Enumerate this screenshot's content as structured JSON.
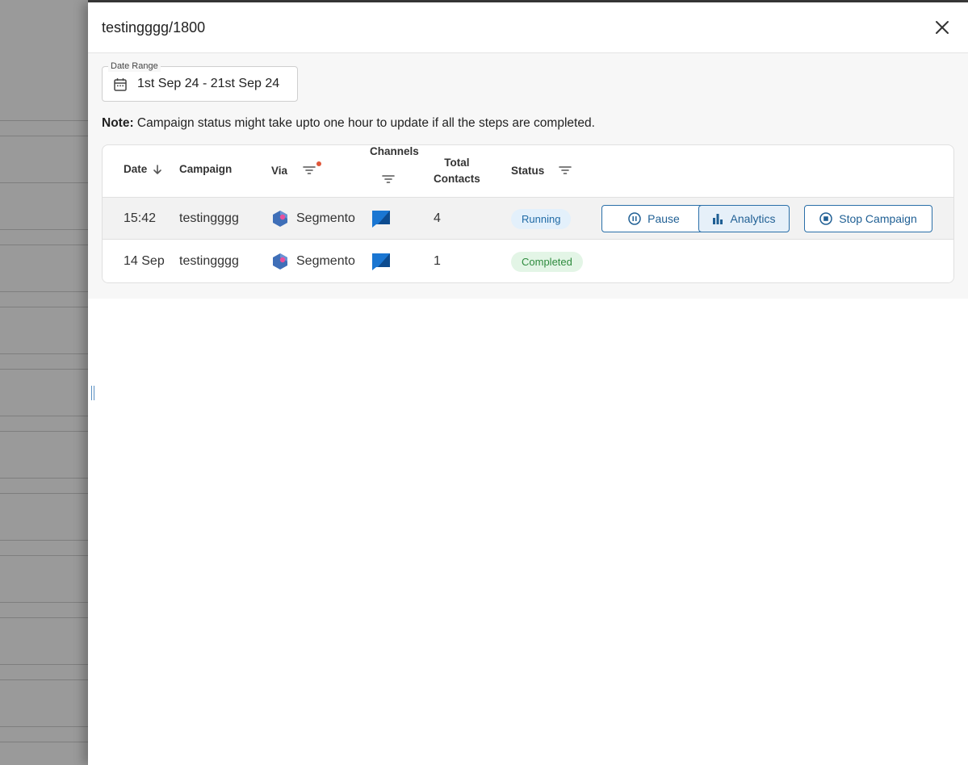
{
  "drawer": {
    "title": "testingggg/1800"
  },
  "date_range": {
    "label": "Date Range",
    "value": "1st Sep 24 - 21st Sep 24"
  },
  "note": {
    "bold": "Note:",
    "text": " Campaign status might take upto one hour to update if all the steps are completed."
  },
  "table": {
    "headers": {
      "date": "Date",
      "campaign": "Campaign",
      "via": "Via",
      "channels": "Channels",
      "total_contacts_line1": "Total",
      "total_contacts_line2": "Contacts",
      "status": "Status"
    },
    "rows": [
      {
        "date": "15:42",
        "campaign": "testingggg",
        "via": "Segmento",
        "contacts": "4",
        "status": "Running",
        "actions": {
          "pause": "Pause",
          "analytics": "Analytics",
          "stop": "Stop Campaign"
        }
      },
      {
        "date": "14 Sep",
        "campaign": "testingggg",
        "via": "Segmento",
        "contacts": "1",
        "status": "Completed"
      }
    ]
  },
  "colors": {
    "accent": "#1f5f94",
    "running_bg": "#e3f0fb",
    "completed_bg": "#e3f5e6",
    "filter_dot": "#e0573a"
  }
}
